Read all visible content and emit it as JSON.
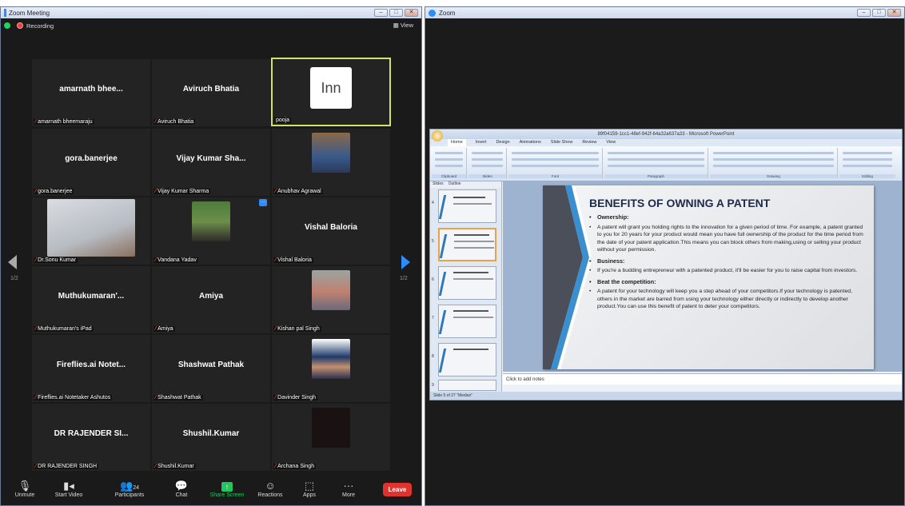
{
  "left_window": {
    "title": "Zoom Meeting",
    "recording_label": "Recording",
    "view_label": "View",
    "page_indicator_left": "1/2",
    "page_indicator_right": "1/2"
  },
  "tiles": [
    {
      "name": "amarnath bhee...",
      "label": "amarnath bheemaraju"
    },
    {
      "name": "Aviruch Bhatia",
      "label": "Aviruch Bhatia"
    },
    {
      "name": "",
      "label": "pooja",
      "logo_text": "Inn"
    },
    {
      "name": "gora.banerjee",
      "label": "gora.banerjee"
    },
    {
      "name": "Vijay Kumar Sha...",
      "label": "Vijay Kumar Sharma"
    },
    {
      "name": "",
      "label": "Anubhav Agrawal"
    },
    {
      "name": "",
      "label": "Dr.Sonu Kumar"
    },
    {
      "name": "",
      "label": "Vandana Yadav"
    },
    {
      "name": "Vishal Baloria",
      "label": "Vishal Baloria"
    },
    {
      "name": "Muthukumaran'...",
      "label": "Muthukumaran's iPad"
    },
    {
      "name": "Amiya",
      "label": "Amiya"
    },
    {
      "name": "",
      "label": "Kishan pal Singh"
    },
    {
      "name": "Fireflies.ai Notet...",
      "label": "Fireflies.ai Notetaker Ashutos"
    },
    {
      "name": "Shashwat Pathak",
      "label": "Shashwat Pathak"
    },
    {
      "name": "",
      "label": "Davinder Singh"
    },
    {
      "name": "DR RAJENDER SI...",
      "label": "DR RAJENDER SINGH"
    },
    {
      "name": "Shushil.Kumar",
      "label": "Shushil.Kumar"
    },
    {
      "name": "",
      "label": "Archana Singh"
    }
  ],
  "toolbar": {
    "unmute": "Unmute",
    "start_video": "Start Video",
    "participants": "Participants",
    "participants_count": "24",
    "chat": "Chat",
    "share_screen": "Share Screen",
    "reactions": "Reactions",
    "apps": "Apps",
    "more": "More",
    "leave": "Leave"
  },
  "right_window": {
    "title": "Zoom"
  },
  "powerpoint": {
    "title": "89f04159-1cc1-48ef-942f-64a32a637a33 - Microsoft PowerPoint",
    "tabs": [
      "Home",
      "Insert",
      "Design",
      "Animations",
      "Slide Show",
      "Review",
      "View"
    ],
    "ribbon_groups": [
      "Clipboard",
      "Slides",
      "Font",
      "Paragraph",
      "Drawing",
      "Editing"
    ],
    "pane_tabs": [
      "Slides",
      "Outline"
    ],
    "notes_placeholder": "Click to add notes",
    "status_text": "Slide 5 of 27   \"Median\"",
    "slide": {
      "title": "BENEFITS OF OWNING A PATENT",
      "sections": [
        {
          "heading": "Ownership:",
          "body": "A patent will grant you holding rights to the innovation for a given period of time. For example, a patent granted to you for 20 years for your product would mean you have full ownership of the product for the time period from the date of your patent application.This means you can block others from making,using or selling your product without your permission."
        },
        {
          "heading": "Business:",
          "body": "If you're a budding entrepreneur with a patented product, it'll be easier for you to raise capital from investors."
        },
        {
          "heading": "Beat the competition:",
          "body": "A patent for your technology will keep you a step ahead of your competitors.If your technology is patented, others in the market are barred from using your technology either directly or indirectly to develop another product.You can use this benefit of patent to deter your competitors."
        }
      ]
    },
    "slide_numbers": [
      "4",
      "5",
      "6",
      "7",
      "8",
      "9"
    ]
  }
}
